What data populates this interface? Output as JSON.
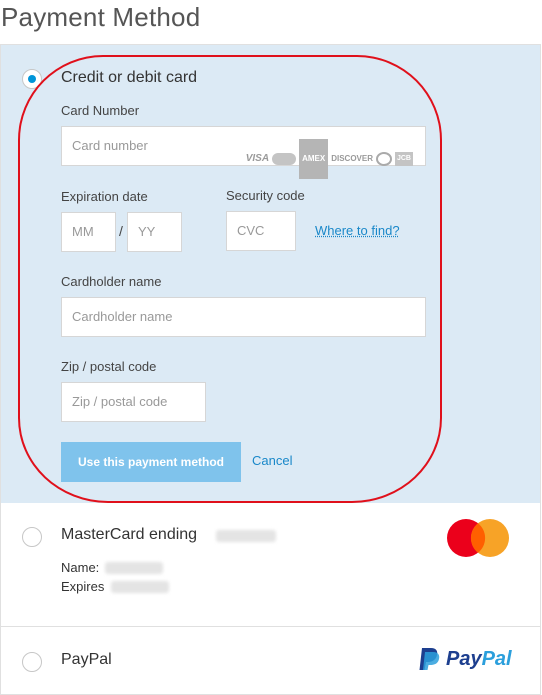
{
  "page": {
    "title": "Payment Method"
  },
  "credit_card": {
    "option_label": "Credit or debit card",
    "card_number_label": "Card Number",
    "card_number_placeholder": "Card number",
    "card_brands": [
      "VISA",
      "MasterCard",
      "AMEX",
      "DISCOVER",
      "Diners",
      "JCB"
    ],
    "expiration_label": "Expiration date",
    "month_placeholder": "MM",
    "year_placeholder": "YY",
    "separator": "/",
    "security_label": "Security code",
    "cvc_placeholder": "CVC",
    "where_to_find": "Where to find?",
    "cardholder_label": "Cardholder name",
    "cardholder_placeholder": "Cardholder name",
    "zip_label": "Zip / postal code",
    "zip_placeholder": "Zip / postal code",
    "use_button": "Use this payment method",
    "cancel": "Cancel"
  },
  "mastercard": {
    "option_label": "MasterCard ending",
    "name_label": "Name:",
    "expires_label": "Expires"
  },
  "paypal": {
    "option_label": "PayPal",
    "logo_part1": "Pay",
    "logo_part2": "Pal"
  },
  "colors": {
    "selected_bg": "#dceaf5",
    "accent": "#0095d9",
    "button": "#7fc3ec",
    "highlight": "#e0101b",
    "mc_red": "#eb001b",
    "mc_orange": "#f79e1b",
    "paypal_dark": "#1d3f8f",
    "paypal_light": "#2b9fdc"
  }
}
